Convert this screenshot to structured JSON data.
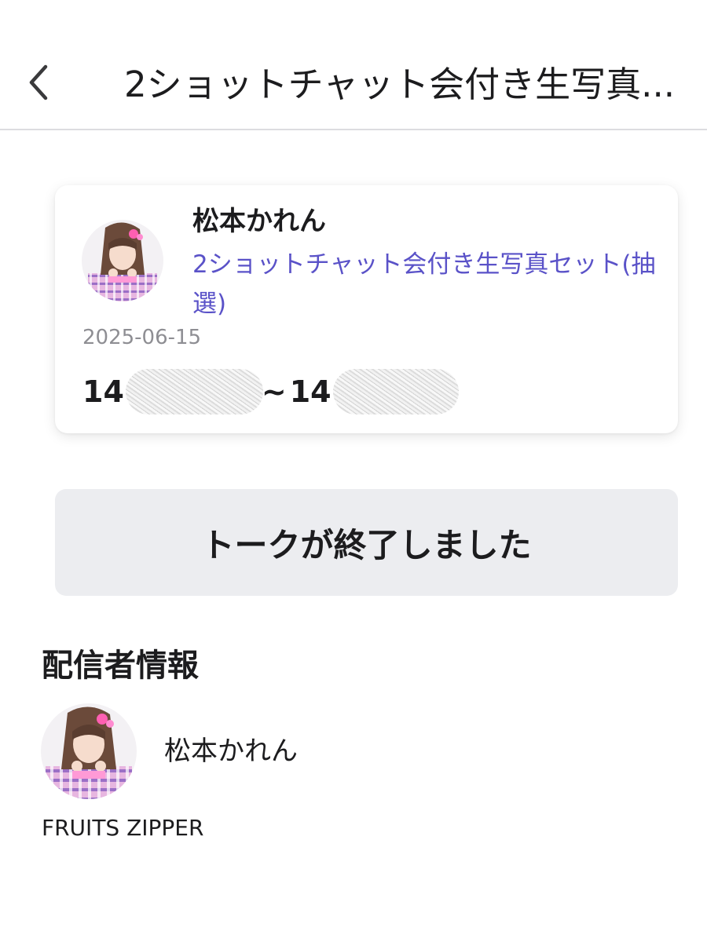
{
  "header": {
    "title": "2ショットチャット会付き生写真...",
    "back_icon": "chevron-left-icon"
  },
  "event_card": {
    "artist_name": "松本かれん",
    "product_title": "2ショットチャット会付き生写真セット(抽選)",
    "date": "2025-06-15",
    "time_start_visible": "14",
    "time_separator": "~",
    "time_end_visible": "14",
    "link_color": "#5a52c8"
  },
  "status": {
    "message": "トークが終了しました"
  },
  "streamer_info": {
    "section_title": "配信者情報",
    "name": "松本かれん",
    "group": "FRUITS ZIPPER"
  }
}
